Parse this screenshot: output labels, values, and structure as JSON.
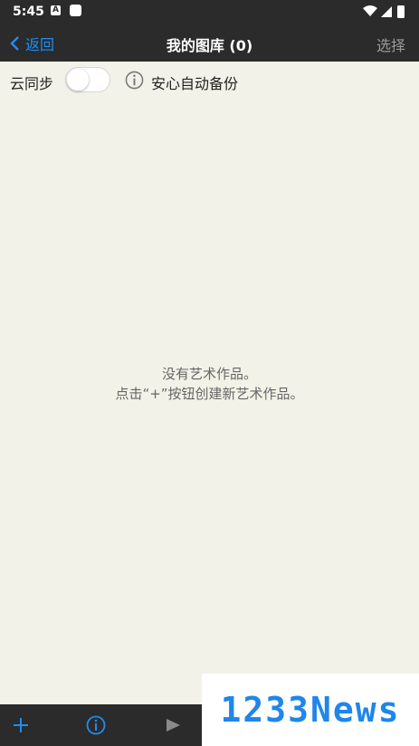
{
  "status_bar": {
    "time": "5:45",
    "badge": "A"
  },
  "nav": {
    "back_label": "返回",
    "title": "我的图库 (0)",
    "select_label": "选择"
  },
  "sync": {
    "label": "云同步",
    "enabled": false,
    "backup_label": "安心自动备份"
  },
  "empty_state": {
    "line1": "没有艺术作品。",
    "line2": "点击“+”按钮创建新艺术作品。"
  },
  "watermark": {
    "text": "1233News"
  },
  "colors": {
    "accent": "#1e8ef3",
    "bar": "#2b2b2b",
    "background": "#f3f2e8"
  }
}
